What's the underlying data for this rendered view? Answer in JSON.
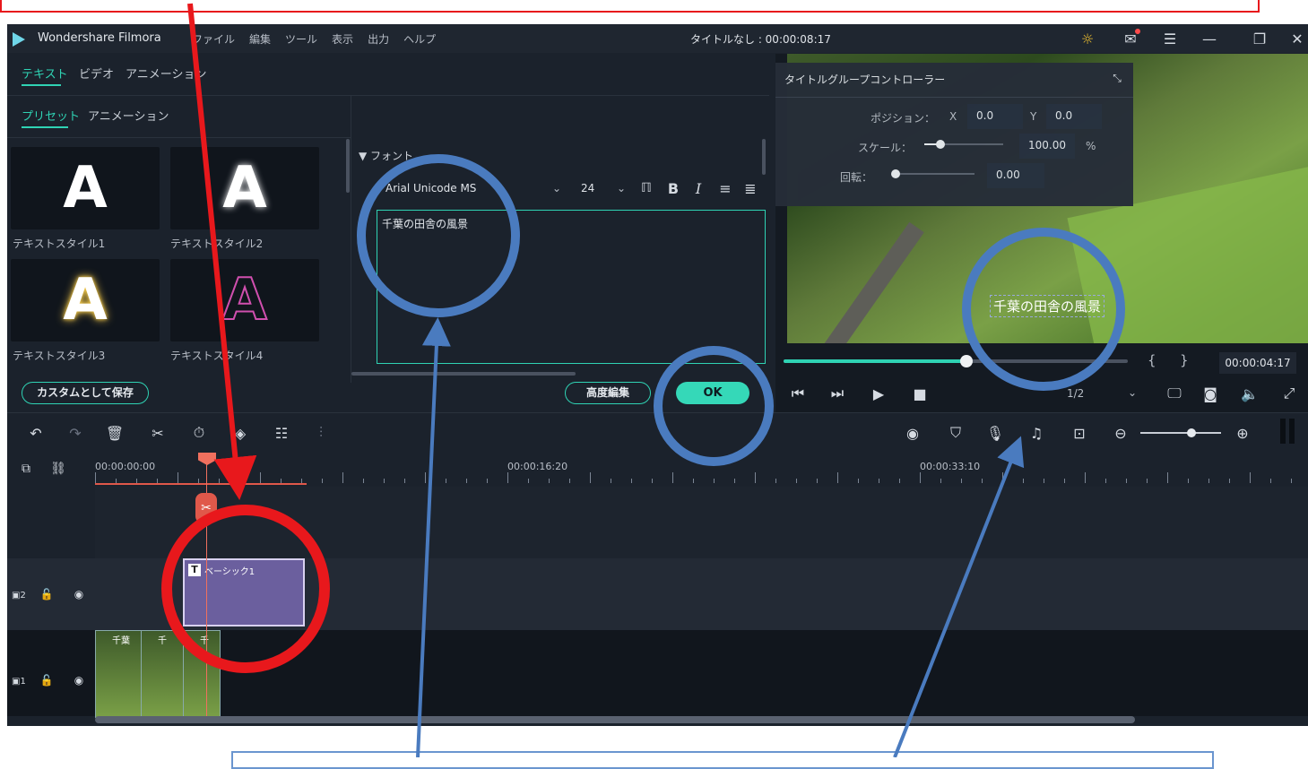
{
  "window": {
    "app_name": "Wondershare Filmora",
    "title": "タイトルなし : 00:00:08:17"
  },
  "menu": [
    "ファイル",
    "編集",
    "ツール",
    "表示",
    "出力",
    "ヘルプ"
  ],
  "top_tabs": [
    "テキスト",
    "ビデオ",
    "アニメーション"
  ],
  "sub_tabs": [
    "プリセット",
    "アニメーション"
  ],
  "presets": [
    {
      "letter": "A",
      "label": "テキストスタイル1"
    },
    {
      "letter": "A",
      "label": "テキストスタイル2"
    },
    {
      "letter": "A",
      "label": "テキストスタイル3"
    },
    {
      "letter": "A",
      "label": "テキストスタイル4"
    }
  ],
  "font_section": {
    "header": "▼ フォント",
    "font_name": "Arial Unicode MS",
    "font_size": "24",
    "text_value": "千葉の田舎の風景"
  },
  "buttons": {
    "save_custom": "カスタムとして保存",
    "advanced": "高度編集",
    "ok": "OK"
  },
  "controller": {
    "title": "タイトルグループコントローラー",
    "position_label": "ポジション：",
    "x_label": "X",
    "x_value": "0.0",
    "y_label": "Y",
    "y_value": "0.0",
    "scale_label": "スケール：",
    "scale_value": "100.00",
    "scale_unit": "%",
    "scale_level": 0.2,
    "rotate_label": "回転：",
    "rotate_value": "0.00",
    "rotate_level": 0.0
  },
  "preview": {
    "overlay_text": "千葉の田舎の風景",
    "time": "00:00:04:17",
    "page": "1/2",
    "progress": 0.53
  },
  "timeline": {
    "ruler_labels": [
      "00:00:00:00",
      "00:00:16:20",
      "00:00:33:10"
    ],
    "title_clip": "ベーシック1",
    "video_clip_labels": [
      "千葉",
      "千",
      "千"
    ],
    "track_labels": [
      "2",
      "1"
    ]
  },
  "colors": {
    "accent": "#2fd3b4",
    "annotation_red": "#e8181c",
    "annotation_blue": "#4a7bbf",
    "playhead": "#f0705e"
  }
}
